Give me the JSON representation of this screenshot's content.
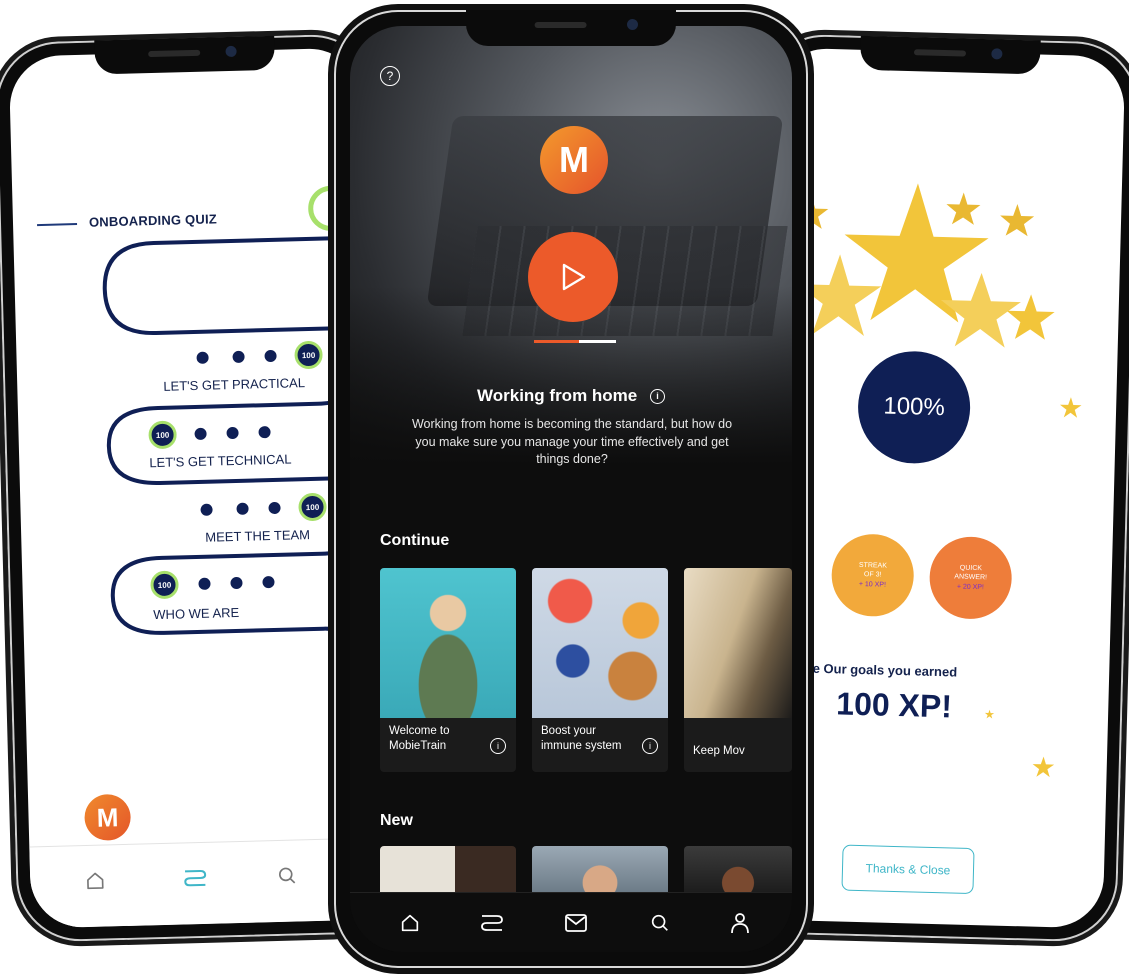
{
  "left_phone": {
    "quiz_title": "ONBOARDING QUIZ",
    "levels": [
      {
        "label": "LET'S GET PRACTICAL",
        "badge": "100"
      },
      {
        "label": "LET'S GET TECHNICAL",
        "badge": "100"
      },
      {
        "label": "MEET THE TEAM",
        "badge": "100"
      },
      {
        "label": "WHO WE ARE",
        "badge": "100"
      }
    ],
    "logo_letter": "M",
    "nav": [
      {
        "name": "home-icon"
      },
      {
        "name": "path-icon"
      },
      {
        "name": "search-icon"
      }
    ]
  },
  "center_phone": {
    "logo_letter": "M",
    "help_glyph": "?",
    "module": {
      "title": "Working from home",
      "description": "Working from home is becoming the standard, but how do you make sure you manage your time effectively and get things done?",
      "progress": 0.55
    },
    "continue_label": "Continue",
    "continue_cards": [
      {
        "caption": "Welcome to MobieTrain"
      },
      {
        "caption": "Boost your immune system"
      },
      {
        "caption": "Keep Mov"
      }
    ],
    "new_label": "New",
    "nav": [
      {
        "name": "home-icon"
      },
      {
        "name": "path-icon"
      },
      {
        "name": "mail-icon"
      },
      {
        "name": "search-icon"
      },
      {
        "name": "profile-icon"
      }
    ]
  },
  "right_phone": {
    "score": "100%",
    "bonuses": [
      {
        "line1": "STREAK",
        "line2": "OF 3!",
        "xp": "+ 10 XP!",
        "color": "#f2a93b"
      },
      {
        "line1": "QUICK",
        "line2": "ANSWER!",
        "xp": "+ 20 XP!",
        "color": "#ee7d3a"
      }
    ],
    "earned_text": "is module Our goals you earned",
    "earned_xp": "100 XP!",
    "thanks_button": "Thanks & Close"
  },
  "colors": {
    "brand_orange": "#ec5a2a",
    "navy": "#0f1f55",
    "teal": "#3fb6c8",
    "star_gold": "#f2c53a",
    "badge_ring": "#a7e06b"
  }
}
